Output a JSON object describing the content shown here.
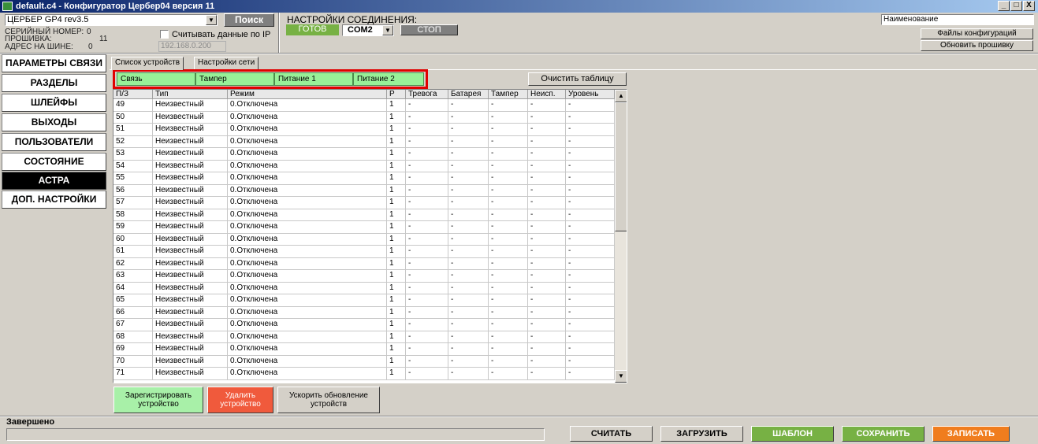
{
  "window": {
    "title": "default.c4 - Конфигуратор Цербер04 версия 11",
    "buttons": [
      "_",
      "□",
      "X"
    ]
  },
  "device": {
    "selected": "ЦЕРБЕР GP4 rev3.5",
    "search_label": "Поиск",
    "serial_label": "СЕРИЙНЫЙ НОМЕР:",
    "serial_value": "0",
    "firmware_label": "ПРОШИВКА:",
    "firmware_value": "11",
    "bus_label": "АДРЕС НА ШИНЕ:",
    "bus_value": "0",
    "read_ip_label": "Считывать данные по IP",
    "ip_value": "192.168.0.200"
  },
  "connection": {
    "label": "НАСТРОЙКИ СОЕДИНЕНИЯ:",
    "ready_label": "ГОТОВ",
    "port": "COM2",
    "stop_label": "СТОП"
  },
  "right": {
    "name_value": "Наименование",
    "config_files_label": "Файлы конфигураций",
    "update_fw_label": "Обновить прошивку"
  },
  "nav": [
    "ПАРАМЕТРЫ СВЯЗИ",
    "РАЗДЕЛЫ",
    "ШЛЕЙФЫ",
    "ВЫХОДЫ",
    "ПОЛЬЗОВАТЕЛИ",
    "СОСТОЯНИЕ",
    "АСТРА",
    "ДОП. НАСТРОЙКИ"
  ],
  "nav_active": "АСТРА",
  "tabs": [
    "Список устройств",
    "Настройки сети"
  ],
  "status_cells": [
    "Связь",
    "Тампер",
    "Питание 1",
    "Питание 2"
  ],
  "clear_label": "Очистить таблицу",
  "table": {
    "headers": [
      "П/З",
      "Тип",
      "Режим",
      "Р",
      "Тревога",
      "Батарея",
      "Тампер",
      "Неисп.",
      "Уровень"
    ],
    "rows": [
      [
        "49",
        "Неизвестный",
        "0.Отключена",
        "1",
        "-",
        "-",
        "-",
        "-",
        "-"
      ],
      [
        "50",
        "Неизвестный",
        "0.Отключена",
        "1",
        "-",
        "-",
        "-",
        "-",
        "-"
      ],
      [
        "51",
        "Неизвестный",
        "0.Отключена",
        "1",
        "-",
        "-",
        "-",
        "-",
        "-"
      ],
      [
        "52",
        "Неизвестный",
        "0.Отключена",
        "1",
        "-",
        "-",
        "-",
        "-",
        "-"
      ],
      [
        "53",
        "Неизвестный",
        "0.Отключена",
        "1",
        "-",
        "-",
        "-",
        "-",
        "-"
      ],
      [
        "54",
        "Неизвестный",
        "0.Отключена",
        "1",
        "-",
        "-",
        "-",
        "-",
        "-"
      ],
      [
        "55",
        "Неизвестный",
        "0.Отключена",
        "1",
        "-",
        "-",
        "-",
        "-",
        "-"
      ],
      [
        "56",
        "Неизвестный",
        "0.Отключена",
        "1",
        "-",
        "-",
        "-",
        "-",
        "-"
      ],
      [
        "57",
        "Неизвестный",
        "0.Отключена",
        "1",
        "-",
        "-",
        "-",
        "-",
        "-"
      ],
      [
        "58",
        "Неизвестный",
        "0.Отключена",
        "1",
        "-",
        "-",
        "-",
        "-",
        "-"
      ],
      [
        "59",
        "Неизвестный",
        "0.Отключена",
        "1",
        "-",
        "-",
        "-",
        "-",
        "-"
      ],
      [
        "60",
        "Неизвестный",
        "0.Отключена",
        "1",
        "-",
        "-",
        "-",
        "-",
        "-"
      ],
      [
        "61",
        "Неизвестный",
        "0.Отключена",
        "1",
        "-",
        "-",
        "-",
        "-",
        "-"
      ],
      [
        "62",
        "Неизвестный",
        "0.Отключена",
        "1",
        "-",
        "-",
        "-",
        "-",
        "-"
      ],
      [
        "63",
        "Неизвестный",
        "0.Отключена",
        "1",
        "-",
        "-",
        "-",
        "-",
        "-"
      ],
      [
        "64",
        "Неизвестный",
        "0.Отключена",
        "1",
        "-",
        "-",
        "-",
        "-",
        "-"
      ],
      [
        "65",
        "Неизвестный",
        "0.Отключена",
        "1",
        "-",
        "-",
        "-",
        "-",
        "-"
      ],
      [
        "66",
        "Неизвестный",
        "0.Отключена",
        "1",
        "-",
        "-",
        "-",
        "-",
        "-"
      ],
      [
        "67",
        "Неизвестный",
        "0.Отключена",
        "1",
        "-",
        "-",
        "-",
        "-",
        "-"
      ],
      [
        "68",
        "Неизвестный",
        "0.Отключена",
        "1",
        "-",
        "-",
        "-",
        "-",
        "-"
      ],
      [
        "69",
        "Неизвестный",
        "0.Отключена",
        "1",
        "-",
        "-",
        "-",
        "-",
        "-"
      ],
      [
        "70",
        "Неизвестный",
        "0.Отключена",
        "1",
        "-",
        "-",
        "-",
        "-",
        "-"
      ],
      [
        "71",
        "Неизвестный",
        "0.Отключена",
        "1",
        "-",
        "-",
        "-",
        "-",
        "-"
      ]
    ]
  },
  "actions": {
    "register": "Зарегистрировать устройство",
    "delete": "Удалить устройство",
    "speedup": "Ускорить обновление устройств"
  },
  "status_text": "Завершено",
  "footer": [
    "СЧИТАТЬ",
    "ЗАГРУЗИТЬ",
    "ШАБЛОН",
    "СОХРАНИТЬ",
    "ЗАПИСАТЬ"
  ],
  "colors": {
    "green": "#77b144",
    "red": "#f05a3c",
    "orange": "#f07d1e",
    "status_green": "#98f098"
  }
}
